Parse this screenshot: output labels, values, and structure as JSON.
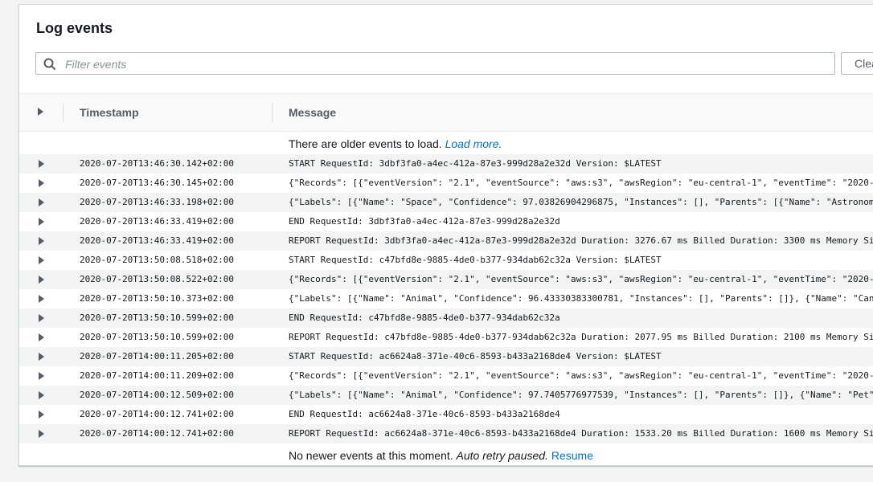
{
  "panel": {
    "title": "Log events",
    "filter_placeholder": "Filter events",
    "clear_label": "Clear"
  },
  "table": {
    "col_timestamp": "Timestamp",
    "col_message": "Message"
  },
  "older": {
    "text": "There are older events to load.",
    "link": "Load more."
  },
  "newer": {
    "text": "No newer events at this moment.",
    "italic": "Auto retry paused.",
    "link": "Resume"
  },
  "rows": [
    {
      "ts": "2020-07-20T13:46:30.142+02:00",
      "msg": "START RequestId: 3dbf3fa0-a4ec-412a-87e3-999d28a2e32d Version: $LATEST"
    },
    {
      "ts": "2020-07-20T13:46:30.145+02:00",
      "msg": "{\"Records\": [{\"eventVersion\": \"2.1\", \"eventSource\": \"aws:s3\", \"awsRegion\": \"eu-central-1\", \"eventTime\": \"2020-0"
    },
    {
      "ts": "2020-07-20T13:46:33.198+02:00",
      "msg": "{\"Labels\": [{\"Name\": \"Space\", \"Confidence\": 97.03826904296875, \"Instances\": [], \"Parents\": [{\"Name\": \"Astronom"
    },
    {
      "ts": "2020-07-20T13:46:33.419+02:00",
      "msg": "END RequestId: 3dbf3fa0-a4ec-412a-87e3-999d28a2e32d"
    },
    {
      "ts": "2020-07-20T13:46:33.419+02:00",
      "msg": "REPORT RequestId: 3dbf3fa0-a4ec-412a-87e3-999d28a2e32d Duration: 3276.67 ms Billed Duration: 3300 ms Memory Si"
    },
    {
      "ts": "2020-07-20T13:50:08.518+02:00",
      "msg": "START RequestId: c47bfd8e-9885-4de0-b377-934dab62c32a Version: $LATEST"
    },
    {
      "ts": "2020-07-20T13:50:08.522+02:00",
      "msg": "{\"Records\": [{\"eventVersion\": \"2.1\", \"eventSource\": \"aws:s3\", \"awsRegion\": \"eu-central-1\", \"eventTime\": \"2020-0"
    },
    {
      "ts": "2020-07-20T13:50:10.373+02:00",
      "msg": "{\"Labels\": [{\"Name\": \"Animal\", \"Confidence\": 96.43330383300781, \"Instances\": [], \"Parents\": []}, {\"Name\": \"Can"
    },
    {
      "ts": "2020-07-20T13:50:10.599+02:00",
      "msg": "END RequestId: c47bfd8e-9885-4de0-b377-934dab62c32a"
    },
    {
      "ts": "2020-07-20T13:50:10.599+02:00",
      "msg": "REPORT RequestId: c47bfd8e-9885-4de0-b377-934dab62c32a Duration: 2077.95 ms Billed Duration: 2100 ms Memory Si"
    },
    {
      "ts": "2020-07-20T14:00:11.205+02:00",
      "msg": "START RequestId: ac6624a8-371e-40c6-8593-b433a2168de4 Version: $LATEST"
    },
    {
      "ts": "2020-07-20T14:00:11.209+02:00",
      "msg": "{\"Records\": [{\"eventVersion\": \"2.1\", \"eventSource\": \"aws:s3\", \"awsRegion\": \"eu-central-1\", \"eventTime\": \"2020-0"
    },
    {
      "ts": "2020-07-20T14:00:12.509+02:00",
      "msg": "{\"Labels\": [{\"Name\": \"Animal\", \"Confidence\": 97.7405776977539, \"Instances\": [], \"Parents\": []}, {\"Name\": \"Pet\""
    },
    {
      "ts": "2020-07-20T14:00:12.741+02:00",
      "msg": "END RequestId: ac6624a8-371e-40c6-8593-b433a2168de4"
    },
    {
      "ts": "2020-07-20T14:00:12.741+02:00",
      "msg": "REPORT RequestId: ac6624a8-371e-40c6-8593-b433a2168de4 Duration: 1533.20 ms Billed Duration: 1600 ms Memory Si"
    }
  ]
}
